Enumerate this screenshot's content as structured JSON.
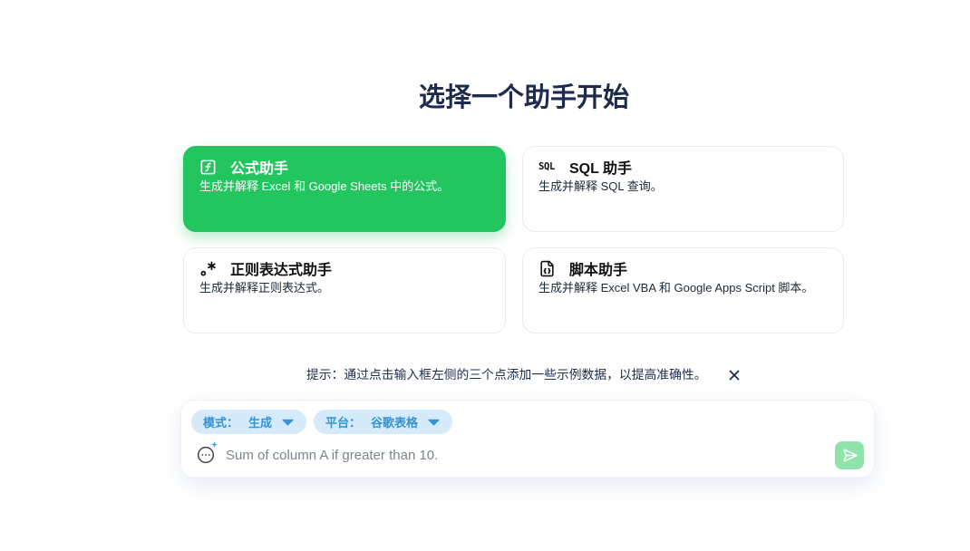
{
  "heading": "选择一个助手开始",
  "assistants": [
    {
      "icon": "square-function-icon",
      "title": "公式助手",
      "description": "生成并解释 Excel 和 Google Sheets 中的公式。",
      "selected": true
    },
    {
      "icon": "sql-icon",
      "icon_text": "SQL",
      "title": "SQL 助手",
      "description": "生成并解释 SQL 查询。",
      "selected": false
    },
    {
      "icon": "regex-icon",
      "title": "正则表达式助手",
      "description": "生成并解释正则表达式。",
      "selected": false
    },
    {
      "icon": "file-code-icon",
      "title": "脚本助手",
      "description": "生成并解释 Excel VBA 和 Google Apps Script 脚本。",
      "selected": false
    }
  ],
  "tip": {
    "text": "提示：通过点击输入框左侧的三个点添加一些示例数据，以提高准确性。",
    "close_icon": "close-icon"
  },
  "composer": {
    "mode": {
      "label": "模式：",
      "value": "生成",
      "icon": "caret-down-icon"
    },
    "platform": {
      "label": "平台：",
      "value": "谷歌表格",
      "icon": "caret-down-icon"
    },
    "examples_icon": "more-horizontal-circle-icon",
    "input": {
      "placeholder": "Sum of column A if greater than 10.",
      "value": ""
    },
    "send_icon": "send-icon"
  },
  "colors": {
    "accent": "#22c55e",
    "heading": "#1e2b4d",
    "pill_bg": "#d5ebfb",
    "pill_text": "#3493d6",
    "send_bg": "#8fe4ac",
    "sparkle": "#3b9ff0"
  }
}
